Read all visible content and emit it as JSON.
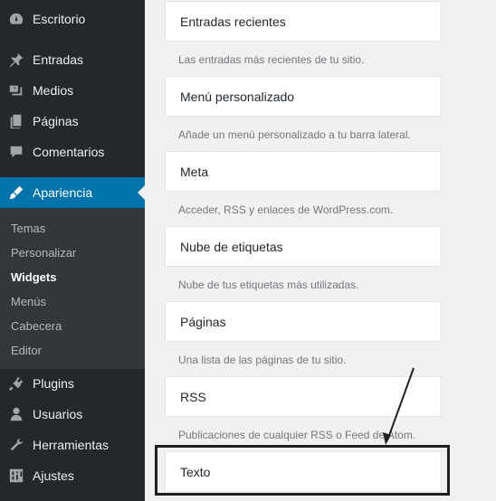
{
  "sidebar": {
    "top_items": [
      {
        "label": "Escritorio",
        "icon": "dashboard-icon"
      },
      {
        "label": "Entradas",
        "icon": "pin-icon"
      },
      {
        "label": "Medios",
        "icon": "media-icon"
      },
      {
        "label": "Páginas",
        "icon": "pages-icon"
      },
      {
        "label": "Comentarios",
        "icon": "comments-icon"
      }
    ],
    "active_item": {
      "label": "Apariencia",
      "icon": "appearance-icon"
    },
    "submenu": [
      "Temas",
      "Personalizar",
      "Widgets",
      "Menús",
      "Cabecera",
      "Editor"
    ],
    "current_submenu": "Widgets",
    "bottom_items": [
      {
        "label": "Plugins",
        "icon": "plugins-icon"
      },
      {
        "label": "Usuarios",
        "icon": "users-icon"
      },
      {
        "label": "Herramientas",
        "icon": "tools-icon"
      },
      {
        "label": "Ajustes",
        "icon": "settings-icon"
      }
    ]
  },
  "widgets": [
    {
      "title": "Entradas recientes",
      "description": "Las entradas más recientes de tu sitio."
    },
    {
      "title": "Menú personalizado",
      "description": "Añade un menú personalizado a tu barra lateral."
    },
    {
      "title": "Meta",
      "description": "Acceder, RSS y enlaces de WordPress.com."
    },
    {
      "title": "Nube de etiquetas",
      "description": "Nube de tus etiquetas más utilizadas."
    },
    {
      "title": "Páginas",
      "description": "Una lista de las páginas de tu sitio."
    },
    {
      "title": "RSS",
      "description": "Publicaciones de cualquier RSS o Feed de Atom."
    },
    {
      "title": "Texto",
      "description": ""
    }
  ],
  "colors": {
    "sidebar": "#23282d",
    "submenu": "#32373c",
    "active": "#0073aa",
    "highlight": "#1f1f1f"
  }
}
